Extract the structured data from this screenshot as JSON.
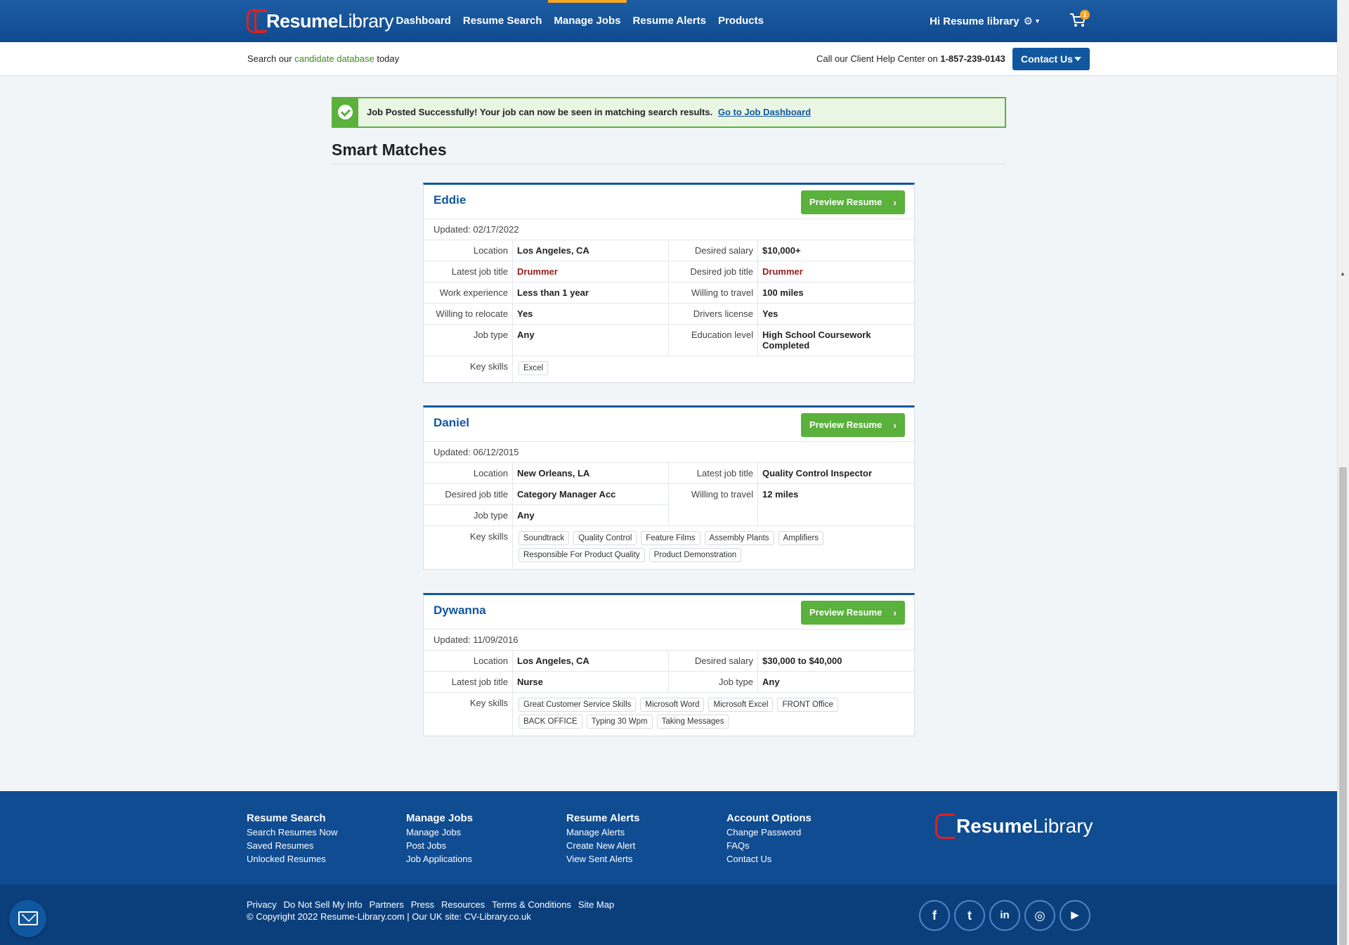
{
  "header": {
    "logo": {
      "word1": "Resume",
      "word2": "Library"
    },
    "nav": [
      "Dashboard",
      "Resume Search",
      "Manage Jobs",
      "Resume Alerts",
      "Products"
    ],
    "active_nav": "Manage Jobs",
    "greeting": "Hi Resume library",
    "cart_count": "1"
  },
  "subbar": {
    "search_prefix": "Search our",
    "search_link": "candidate database",
    "search_suffix": "today",
    "help_text": "Call our Client Help Center on",
    "phone": "1-857-239-0143",
    "contact_label": "Contact Us"
  },
  "alert": {
    "message": "Job Posted Successfully! Your job can now be seen in matching search results.",
    "link": "Go to Job Dashboard"
  },
  "page_title": "Smart Matches",
  "preview_label": "Preview Resume",
  "candidates": [
    {
      "name": "Eddie",
      "updated": "Updated: 02/17/2022",
      "fields": [
        {
          "l1": "Location",
          "v1": "Los Angeles, CA",
          "l2": "Desired salary",
          "v2": "$10,000+"
        },
        {
          "l1": "Latest job title",
          "v1": "Drummer",
          "l2": "Desired job title",
          "v2": "Drummer"
        },
        {
          "l1": "Work experience",
          "v1": "Less than 1 year",
          "l2": "Willing to travel",
          "v2": "100 miles"
        },
        {
          "l1": "Willing to relocate",
          "v1": "Yes",
          "l2": "Drivers license",
          "v2": "Yes"
        },
        {
          "l1": "Job type",
          "v1": "Any",
          "l2": "Education level",
          "v2": "High School Coursework Completed"
        }
      ],
      "skills_label": "Key skills",
      "skills": [
        "Excel"
      ]
    },
    {
      "name": "Daniel",
      "updated": "Updated: 06/12/2015",
      "fields": [
        {
          "l1": "Location",
          "v1": "New Orleans, LA",
          "l2": "Latest job title",
          "v2": "Quality Control Inspector"
        },
        {
          "l1": "Desired job title",
          "v1": "Category Manager Acc",
          "l2": "Willing to travel",
          "v2": "12 miles"
        },
        {
          "l1": "Job type",
          "v1": "Any",
          "l2": "",
          "v2": ""
        }
      ],
      "skills_label": "Key skills",
      "skills": [
        "Soundtrack",
        "Quality Control",
        "Feature Films",
        "Assembly Plants",
        "Amplifiers",
        "Responsible For Product Quality",
        "Product Demonstration"
      ]
    },
    {
      "name": "Dywanna",
      "updated": "Updated: 11/09/2016",
      "fields": [
        {
          "l1": "Location",
          "v1": "Los Angeles, CA",
          "l2": "Desired salary",
          "v2": "$30,000 to $40,000"
        },
        {
          "l1": "Latest job title",
          "v1": "Nurse",
          "l2": "Job type",
          "v2": "Any"
        }
      ],
      "skills_label": "Key skills",
      "skills": [
        "Great Customer Service Skills",
        "Microsoft Word",
        "Microsoft Excel",
        "FRONT Office",
        "BACK OFFICE",
        "Typing 30 Wpm",
        "Taking Messages"
      ]
    }
  ],
  "footer": {
    "columns": [
      {
        "title": "Resume Search",
        "links": [
          "Search Resumes Now",
          "Saved Resumes",
          "Unlocked Resumes"
        ]
      },
      {
        "title": "Manage Jobs",
        "links": [
          "Manage Jobs",
          "Post Jobs",
          "Job Applications"
        ]
      },
      {
        "title": "Resume Alerts",
        "links": [
          "Manage Alerts",
          "Create New Alert",
          "View Sent Alerts"
        ]
      },
      {
        "title": "Account Options",
        "links": [
          "Change Password",
          "FAQs",
          "Contact Us"
        ]
      }
    ],
    "bottom_links": [
      "Privacy",
      "Do Not Sell My Info",
      "Partners",
      "Press",
      "Resources",
      "Terms & Conditions",
      "Site Map"
    ],
    "copyright": "© Copyright 2022 Resume-Library.com | Our UK site: CV-Library.co.uk",
    "social": [
      {
        "icon": "facebook-icon",
        "glyph": "f"
      },
      {
        "icon": "twitter-icon",
        "glyph": "t"
      },
      {
        "icon": "linkedin-icon",
        "glyph": "in"
      },
      {
        "icon": "instagram-icon",
        "glyph": "◎"
      },
      {
        "icon": "youtube-icon",
        "glyph": "▶"
      }
    ]
  },
  "colors": {
    "brand_blue": "#11579f",
    "success_green": "#5ab13c",
    "accent_orange": "#f5a623",
    "title_red": "#9a1b1b"
  }
}
